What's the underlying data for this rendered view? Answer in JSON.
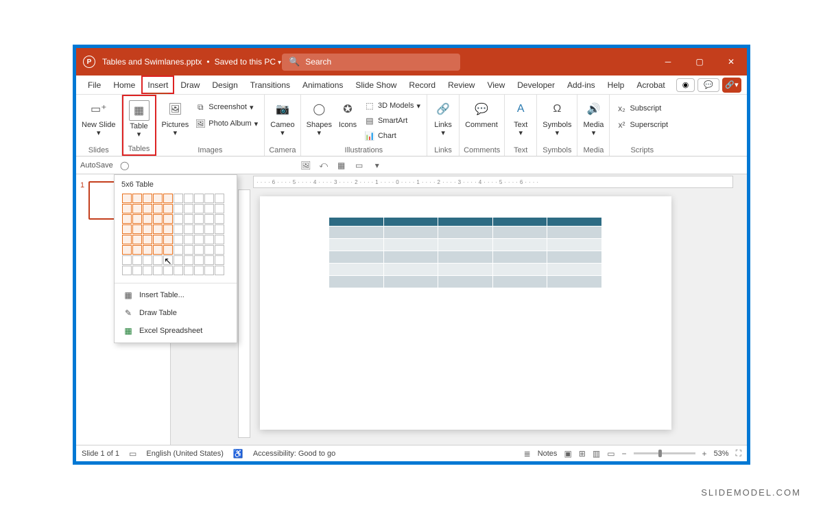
{
  "titlebar": {
    "filename": "Tables and Swimlanes.pptx",
    "saved_status": "Saved to this PC",
    "search_placeholder": "Search"
  },
  "tabs": [
    "File",
    "Home",
    "Insert",
    "Draw",
    "Design",
    "Transitions",
    "Animations",
    "Slide Show",
    "Record",
    "Review",
    "View",
    "Developer",
    "Add-ins",
    "Help",
    "Acrobat"
  ],
  "ribbon": {
    "slides": {
      "new_slide": "New Slide",
      "label": "Slides"
    },
    "tables": {
      "table": "Table",
      "label": "Tables"
    },
    "images": {
      "pictures": "Pictures",
      "screenshot": "Screenshot",
      "photo_album": "Photo Album",
      "label": "Images"
    },
    "camera": {
      "cameo": "Cameo",
      "label": "Camera"
    },
    "illustrations": {
      "shapes": "Shapes",
      "icons": "Icons",
      "models": "3D Models",
      "smartart": "SmartArt",
      "chart": "Chart",
      "label": "Illustrations"
    },
    "links": {
      "links": "Links",
      "label": "Links"
    },
    "comments": {
      "comment": "Comment",
      "label": "Comments"
    },
    "text": {
      "text": "Text",
      "label": "Text"
    },
    "symbols": {
      "symbols": "Symbols",
      "label": "Symbols"
    },
    "media": {
      "media": "Media",
      "label": "Media"
    },
    "scripts": {
      "subscript": "Subscript",
      "superscript": "Superscript",
      "label": "Scripts"
    }
  },
  "quickbar": {
    "autosave": "AutoSave"
  },
  "table_dropdown": {
    "title": "5x6 Table",
    "selected_cols": 5,
    "selected_rows": 6,
    "grid_cols": 10,
    "grid_rows": 8,
    "insert_table": "Insert Table...",
    "draw_table": "Draw Table",
    "excel_spreadsheet": "Excel Spreadsheet"
  },
  "thumbnails": {
    "slide1_num": "1"
  },
  "ruler_text": "····6····5····4····3····2····1····0····1····2····3····4····5····6····",
  "statusbar": {
    "slide_info": "Slide 1 of 1",
    "language": "English (United States)",
    "accessibility": "Accessibility: Good to go",
    "notes": "Notes",
    "zoom": "53%"
  },
  "watermark": "SLIDEMODEL.COM"
}
